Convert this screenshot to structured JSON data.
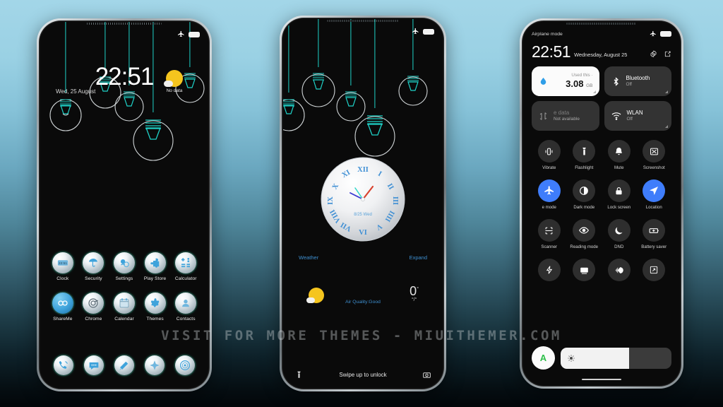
{
  "watermark": "VISIT FOR MORE THEMES - MIUITHEMER.COM",
  "theme": {
    "accent_teal": "#1fd2c8",
    "accent_blue": "#3f7dfb",
    "link_blue": "#3e8fd0",
    "sun_yellow": "#f5c51e",
    "bg_top": "#a3d6e8",
    "bg_bottom": "#020609"
  },
  "phone1": {
    "lockscreen": {
      "time": "22:51",
      "date": "Wed, 25 August",
      "weather_status": "No data",
      "weather_icon": "sun-cloud-icon"
    },
    "statusbar": {
      "airplane_icon": "airplane-icon",
      "battery_icon": "battery-icon"
    },
    "apps": [
      {
        "label": "Clock",
        "icon": "clock-icon"
      },
      {
        "label": "Security",
        "icon": "shield-umbrella-icon"
      },
      {
        "label": "Settings",
        "icon": "gear-icon"
      },
      {
        "label": "Play Store",
        "icon": "play-store-icon"
      },
      {
        "label": "Calculator",
        "icon": "calculator-icon"
      },
      {
        "label": "ShareMe",
        "icon": "shareme-icon"
      },
      {
        "label": "Chrome",
        "icon": "chrome-icon"
      },
      {
        "label": "Calendar",
        "icon": "calendar-icon"
      },
      {
        "label": "Themes",
        "icon": "themes-icon"
      },
      {
        "label": "Contacts",
        "icon": "contacts-icon"
      }
    ],
    "dock": [
      {
        "label": "Phone",
        "icon": "phone-icon"
      },
      {
        "label": "Messages",
        "icon": "messages-icon"
      },
      {
        "label": "Mi Video",
        "icon": "video-icon"
      },
      {
        "label": "Gallery",
        "icon": "gallery-icon"
      },
      {
        "label": "Browser",
        "icon": "browser-icon"
      }
    ]
  },
  "phone2": {
    "statusbar": {
      "airplane_icon": "airplane-icon",
      "battery_icon": "battery-icon"
    },
    "clock": {
      "type": "analog-roman",
      "numerals": [
        "I",
        "II",
        "III",
        "IIII",
        "V",
        "VI",
        "VII",
        "VIII",
        "IX",
        "X",
        "XI",
        "XII"
      ],
      "center_label": "8/25 Wed",
      "hour_hand_color": "#d9432f",
      "minute_hand_color": "#3a3ad1",
      "second_hand_color": "#2fd8c8"
    },
    "links": {
      "weather": "Weather",
      "expand": "Expand"
    },
    "weather": {
      "icon": "sun-cloud-icon",
      "air_quality": "Air Quality:Good",
      "temperature": "0",
      "degree": "°",
      "range": "°/°"
    },
    "bottom": {
      "flashlight_icon": "flashlight-icon",
      "hint": "Swipe up to unlock",
      "camera_icon": "camera-icon"
    }
  },
  "phone3": {
    "statusbar": {
      "label": "Airplane mode",
      "airplane_icon": "airplane-icon",
      "battery_icon": "battery-icon"
    },
    "header": {
      "time": "22:51",
      "date": "Wednesday, August 25",
      "settings_icon": "gear-icon",
      "edit_icon": "edit-icon"
    },
    "big_tiles": [
      {
        "icon": "data-usage-icon",
        "usage_label": "Used this ·",
        "value": "3.08",
        "unit": "GB",
        "style": "light"
      },
      {
        "icon": "bluetooth-icon",
        "title": "Bluetooth",
        "sub": "Off",
        "style": "dark"
      },
      {
        "icon": "mobile-data-icon",
        "title": "e data",
        "sub": "Not available",
        "style": "dark-muted"
      },
      {
        "icon": "wifi-icon",
        "title": "WLAN",
        "sub": "Off",
        "style": "dark"
      }
    ],
    "toggles_row1": [
      {
        "label": "Vibrate",
        "icon": "vibrate-icon",
        "active": false
      },
      {
        "label": "Flashlight",
        "icon": "flashlight-icon",
        "active": false
      },
      {
        "label": "Mute",
        "icon": "bell-icon",
        "active": false
      },
      {
        "label": "Screenshot",
        "icon": "screenshot-icon",
        "active": false
      }
    ],
    "toggles_row2": [
      {
        "label": "e mode",
        "icon": "airplane-icon",
        "active": true
      },
      {
        "label": "Dark mode",
        "icon": "contrast-icon",
        "active": false
      },
      {
        "label": "Lock screen",
        "icon": "lock-icon",
        "active": false
      },
      {
        "label": "Location",
        "icon": "location-icon",
        "active": true
      }
    ],
    "toggles_row3": [
      {
        "label": "Scanner",
        "icon": "scanner-icon",
        "active": false
      },
      {
        "label": "Reading mode",
        "icon": "eye-icon",
        "active": false
      },
      {
        "label": "DND",
        "icon": "moon-icon",
        "active": false
      },
      {
        "label": "Battery saver",
        "icon": "battery-saver-icon",
        "active": false
      }
    ],
    "toggles_row4": [
      {
        "label": "",
        "icon": "lightning-icon",
        "active": false
      },
      {
        "label": "",
        "icon": "cast-icon",
        "active": false
      },
      {
        "label": "",
        "icon": "ultra-icon",
        "active": false
      },
      {
        "label": "",
        "icon": "expand-icon",
        "active": false
      }
    ],
    "brightness": {
      "auto_label": "A",
      "icon": "brightness-icon",
      "level_percent": 62
    }
  }
}
